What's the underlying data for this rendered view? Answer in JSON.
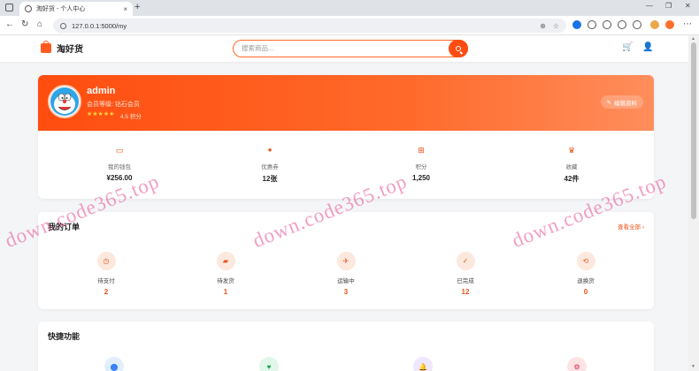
{
  "browser": {
    "tab_title": "淘好货 - 个人中心",
    "url": "127.0.0.1:5000/my",
    "new_tab": "+",
    "close_tab": "×",
    "win_min": "—",
    "win_max": "❐",
    "win_close": "✕",
    "back": "←",
    "reload": "↻",
    "home": "⌂",
    "zoom": "⊕",
    "star": "☆",
    "menu": "⋯"
  },
  "site": {
    "logo_text": "淘好货",
    "search_placeholder": "搜索商品...",
    "cart_icon": "🛒",
    "user_icon": "👤"
  },
  "profile": {
    "username": "admin",
    "level_text": "会员等级: 钻石会员",
    "stars": "★★★★★",
    "score_text": "4.5 积分",
    "edit_label": "编辑资料",
    "stats": [
      {
        "label": "我的钱包",
        "value": "¥256.00",
        "icon": "wallet-icon",
        "glyph": "▭"
      },
      {
        "label": "优惠券",
        "value": "12张",
        "icon": "ticket-icon",
        "glyph": "✦"
      },
      {
        "label": "积分",
        "value": "1,250",
        "icon": "gift-icon",
        "glyph": "⊞"
      },
      {
        "label": "收藏",
        "value": "42件",
        "icon": "trophy-icon",
        "glyph": "♛"
      }
    ]
  },
  "orders": {
    "title": "我的订单",
    "view_all": "查看全部 ›",
    "items": [
      {
        "label": "待支付",
        "count": "2",
        "icon": "clock-icon",
        "glyph": "◷"
      },
      {
        "label": "待发货",
        "count": "1",
        "icon": "truck-icon",
        "glyph": "▰"
      },
      {
        "label": "运输中",
        "count": "3",
        "icon": "plane-icon",
        "glyph": "✈"
      },
      {
        "label": "已完成",
        "count": "12",
        "icon": "check-icon",
        "glyph": "✓"
      },
      {
        "label": "退换货",
        "count": "0",
        "icon": "exchange-icon",
        "glyph": "⟲"
      }
    ]
  },
  "quick": {
    "title": "快捷功能",
    "items": [
      {
        "icon": "location-icon",
        "glyph": "⬤",
        "bg": "#e3efff",
        "color": "#3b82f6"
      },
      {
        "icon": "heart-icon",
        "glyph": "♥",
        "bg": "#e0f7ea",
        "color": "#16a34a"
      },
      {
        "icon": "bell-icon",
        "glyph": "🔔",
        "bg": "#efe6ff",
        "color": "#8b5cf6"
      },
      {
        "icon": "gear-icon",
        "glyph": "⚙",
        "bg": "#fde4e4",
        "color": "#e11d48"
      }
    ]
  },
  "watermark": {
    "text": "down.code365.top"
  },
  "colors": {
    "accent": "#ff4d12",
    "banner_start": "#ff4d0f",
    "banner_end": "#ff8e5c",
    "watermark": "#e65096"
  }
}
